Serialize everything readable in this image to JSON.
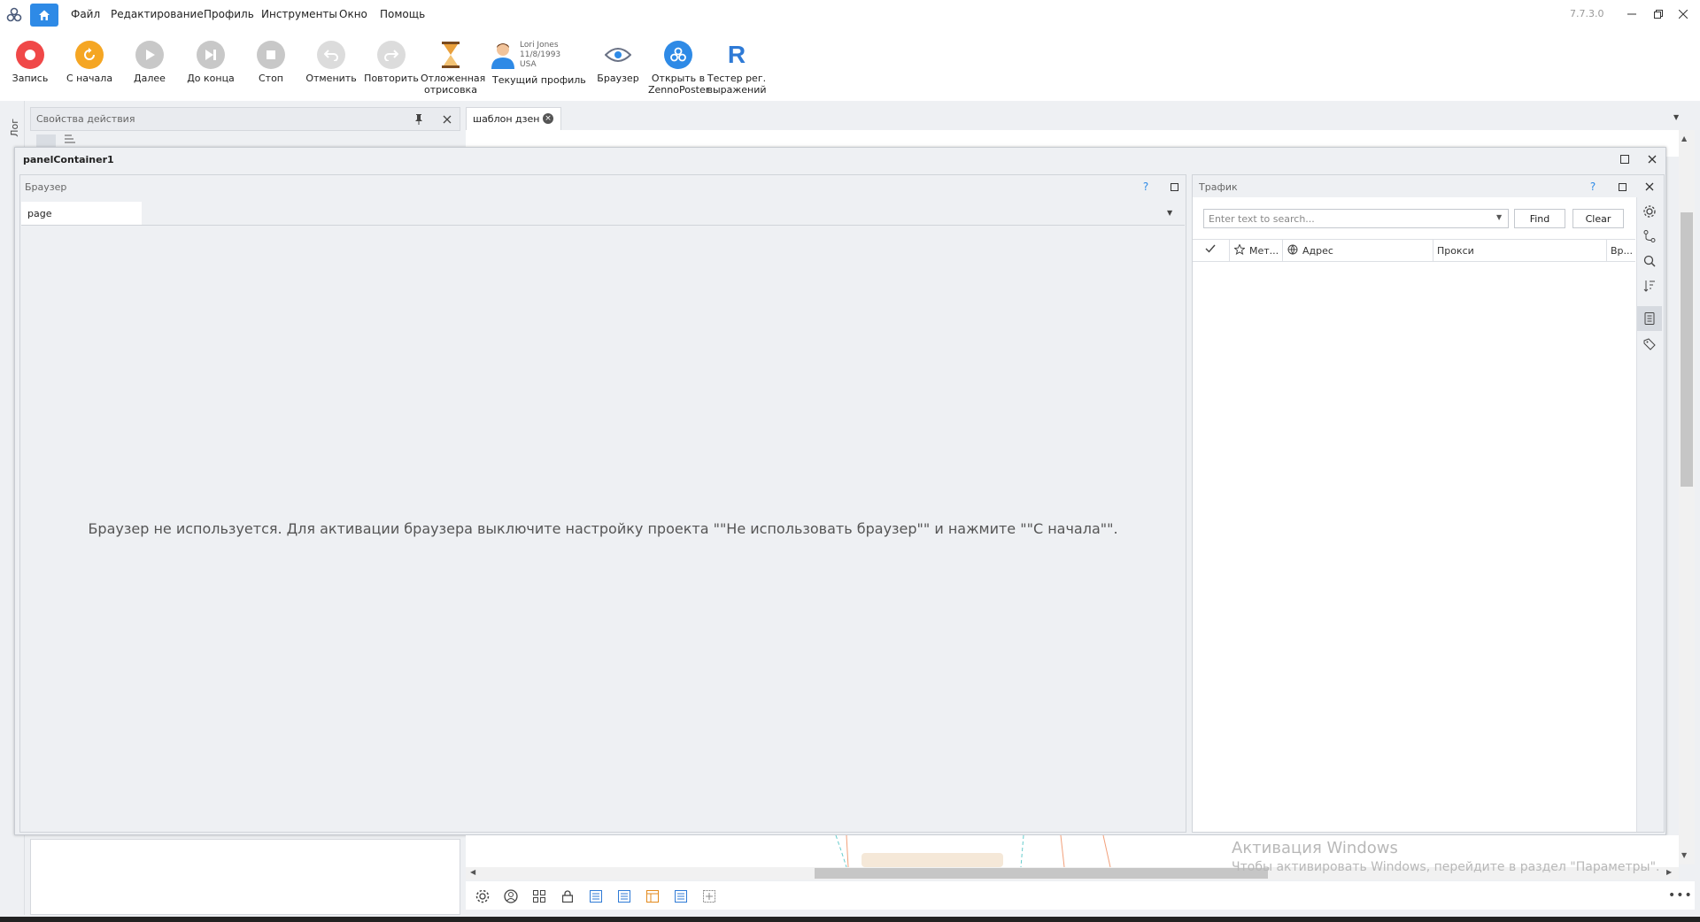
{
  "menu": {
    "items": [
      "Файл",
      "Редактирование",
      "Профиль",
      "Инструменты",
      "Окно",
      "Помощь"
    ],
    "version": "7.7.3.0"
  },
  "toolbar": {
    "record": "Запись",
    "restart": "С начала",
    "next": "Далее",
    "to_end": "До конца",
    "stop": "Стоп",
    "undo": "Отменить",
    "redo": "Повторить",
    "deferred_1": "Отложенная",
    "deferred_2": "отрисовка",
    "profile_label": "Текущий профиль",
    "profile_name": "Lori Jones",
    "profile_dob": "11/8/1993",
    "profile_country": "USA",
    "browser": "Браузер",
    "open_zp_1": "Открыть в",
    "open_zp_2": "ZennoPoster",
    "regex_1": "Тестер рег.",
    "regex_2": "выражений"
  },
  "left_strip": {
    "label": "Лог"
  },
  "props": {
    "title": "Свойства действия"
  },
  "document": {
    "tab": "шаблон дзен"
  },
  "panel_container": {
    "title": "panelContainer1"
  },
  "browser_panel": {
    "title": "Браузер",
    "tab": "page",
    "message": "Браузер не используется. Для активации браузера выключите настройку проекта \"\"Не использовать браузер\"\" и нажмите \"\"С начала\"\"."
  },
  "traffic_panel": {
    "title": "Трафик",
    "search_placeholder": "Enter text to search...",
    "find": "Find",
    "clear": "Clear",
    "columns": [
      "Мет...",
      "Адрес",
      "Прокси",
      "Вр..."
    ]
  },
  "watermark": {
    "title": "Активация Windows",
    "subtitle": "Чтобы активировать Windows, перейдите в раздел \"Параметры\"."
  },
  "colors": {
    "accent": "#2e8ae6",
    "record": "#f04848",
    "restart": "#f5a623",
    "disabled": "#c8c8c8"
  }
}
